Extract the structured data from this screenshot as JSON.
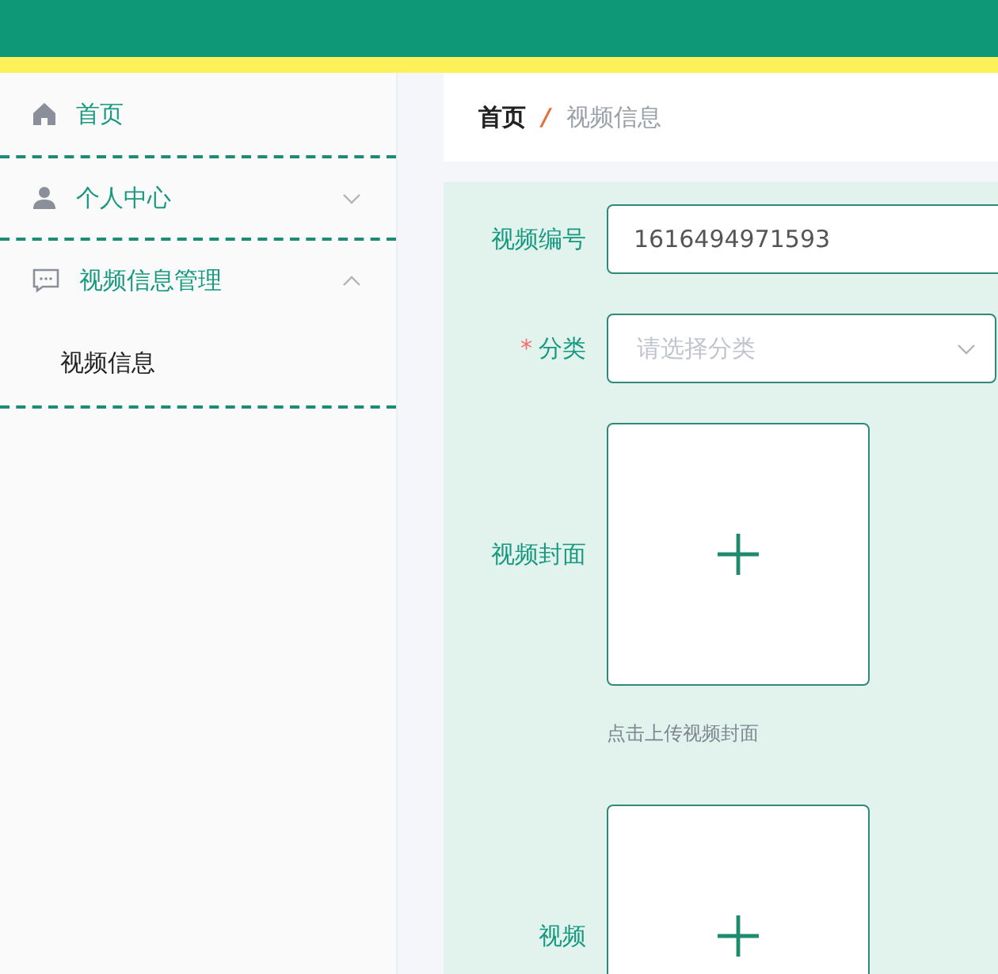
{
  "sidebar": {
    "items": [
      {
        "label": "首页"
      },
      {
        "label": "个人中心",
        "expanded": false
      },
      {
        "label": "视频信息管理",
        "expanded": true,
        "children": [
          {
            "label": "视频信息"
          }
        ]
      }
    ]
  },
  "breadcrumb": [
    {
      "label": "首页",
      "current": false
    },
    {
      "label": "视频信息",
      "current": true
    }
  ],
  "breadcrumb_separator": "/",
  "form": {
    "fields": [
      {
        "kind": "text",
        "label": "视频编号",
        "value": "1616494971593"
      },
      {
        "kind": "select",
        "label": "分类",
        "required": true,
        "placeholder": "请选择分类"
      },
      {
        "kind": "upload",
        "label": "视频封面",
        "hint": "点击上传视频封面"
      },
      {
        "kind": "upload",
        "label": "视频"
      }
    ]
  },
  "required_mark": "*"
}
